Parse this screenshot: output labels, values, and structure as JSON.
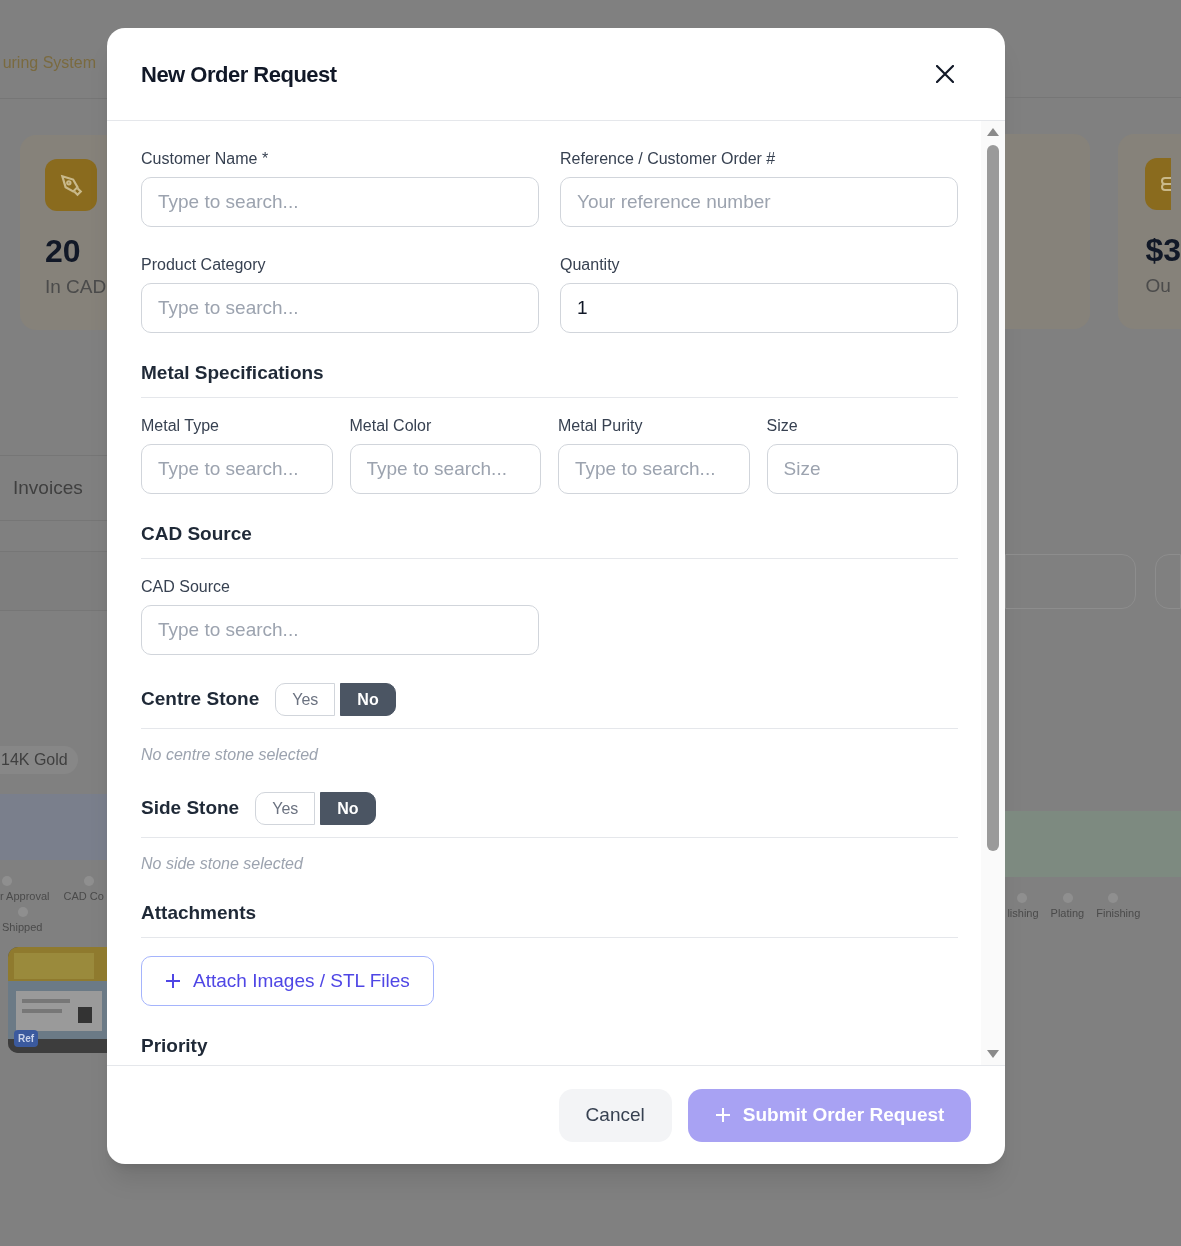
{
  "background": {
    "subtitle": "uring System",
    "stat_cards": [
      {
        "value": "20",
        "label": "In CAD"
      },
      {
        "value": "$3",
        "label": "Ou"
      }
    ],
    "tab": "Invoices",
    "chip": "14K Gold",
    "steps_left": [
      {
        "label": "r Approval"
      },
      {
        "label": "CAD Co"
      },
      {
        "label": "Shipped"
      }
    ],
    "steps_right": [
      {
        "label": "lishing"
      },
      {
        "label": "Plating"
      },
      {
        "label": "Finishing"
      }
    ],
    "photo": {
      "kind": "picture",
      "badge": "Ref"
    }
  },
  "modal": {
    "title": "New Order Request",
    "sections": [
      {
        "kind": "fields",
        "fields": [
          {
            "label": "Customer Name *",
            "placeholder": "Type to search..."
          },
          {
            "label": "Reference / Customer Order #",
            "placeholder": "Your reference number"
          }
        ]
      },
      {
        "kind": "fields",
        "fields": [
          {
            "label": "Product Category",
            "placeholder": "Type to search..."
          },
          {
            "label": "Quantity",
            "value": "1"
          }
        ]
      },
      {
        "kind": "heading",
        "text": "Metal Specifications"
      },
      {
        "kind": "fields",
        "fields": [
          {
            "label": "Metal Type",
            "placeholder": "Type to search..."
          },
          {
            "label": "Metal Color",
            "placeholder": "Type to search..."
          },
          {
            "label": "Metal Purity",
            "placeholder": "Type to search..."
          },
          {
            "label": "Size",
            "placeholder": "Size"
          }
        ]
      },
      {
        "kind": "heading",
        "text": "CAD Source"
      },
      {
        "kind": "fields",
        "fields": [
          {
            "label": "CAD Source",
            "placeholder": "Type to search..."
          }
        ]
      },
      {
        "kind": "toggle",
        "label": "Centre Stone",
        "options": [
          {
            "label": "Yes",
            "selected": false
          },
          {
            "label": "No",
            "selected": true
          }
        ],
        "note": "No centre stone selected"
      },
      {
        "kind": "toggle",
        "label": "Side Stone",
        "options": [
          {
            "label": "Yes",
            "selected": false
          },
          {
            "label": "No",
            "selected": true
          }
        ],
        "note": "No side stone selected"
      },
      {
        "kind": "heading",
        "text": "Attachments"
      },
      {
        "kind": "button",
        "label": "Attach Images / STL Files"
      },
      {
        "kind": "subheading",
        "text": "Priority"
      }
    ],
    "cancel": "Cancel",
    "submit": {
      "label": "Submit Order Request",
      "disabled": true
    }
  }
}
